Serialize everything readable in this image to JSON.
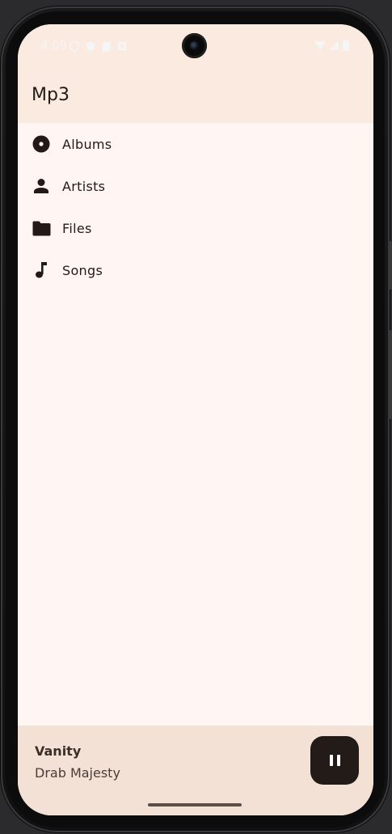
{
  "status_bar": {
    "time": "4:09",
    "left_icons": [
      "shield-icon",
      "shield-filled-icon",
      "sim-card-icon",
      "notification-icon"
    ],
    "right_icons": [
      "wifi-icon",
      "signal-icon",
      "battery-icon"
    ]
  },
  "app_bar": {
    "title": "Mp3"
  },
  "menu": {
    "items": [
      {
        "label": "Albums",
        "icon": "album-icon"
      },
      {
        "label": "Artists",
        "icon": "person-icon"
      },
      {
        "label": "Files",
        "icon": "folder-icon"
      },
      {
        "label": "Songs",
        "icon": "music-note-icon"
      }
    ]
  },
  "player": {
    "title": "Vanity",
    "artist": "Drab Majesty",
    "state_icon": "pause-icon"
  },
  "colors": {
    "app_bar_bg": "#fbeae0",
    "content_bg": "#fff6f3",
    "player_bg": "#f3e1d5",
    "button_bg": "#221b17",
    "text": "#221a16"
  }
}
